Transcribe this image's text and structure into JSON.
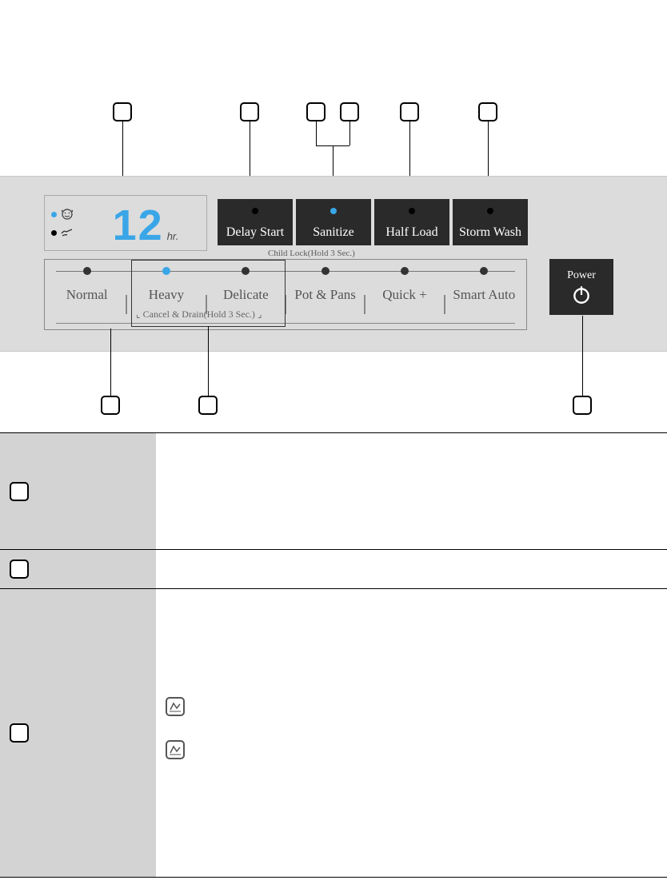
{
  "display": {
    "digits": "12",
    "unit": "hr."
  },
  "dark_buttons": [
    {
      "label": "Delay Start",
      "on": false
    },
    {
      "label": "Sanitize",
      "on": true
    },
    {
      "label": "Half Load",
      "on": false
    },
    {
      "label": "Storm Wash",
      "on": false
    }
  ],
  "child_lock_hint": "Child Lock(Hold 3 Sec.)",
  "cycles": [
    {
      "label": "Normal",
      "on": false
    },
    {
      "label": "Heavy",
      "on": true
    },
    {
      "label": "Delicate",
      "on": false
    },
    {
      "label": "Pot & Pans",
      "on": false
    },
    {
      "label": "Quick +",
      "on": false
    },
    {
      "label": "Smart Auto",
      "on": false
    }
  ],
  "cancel_drain_hint": "Cancel & Drain(Hold 3 Sec.)",
  "power_label": "Power"
}
